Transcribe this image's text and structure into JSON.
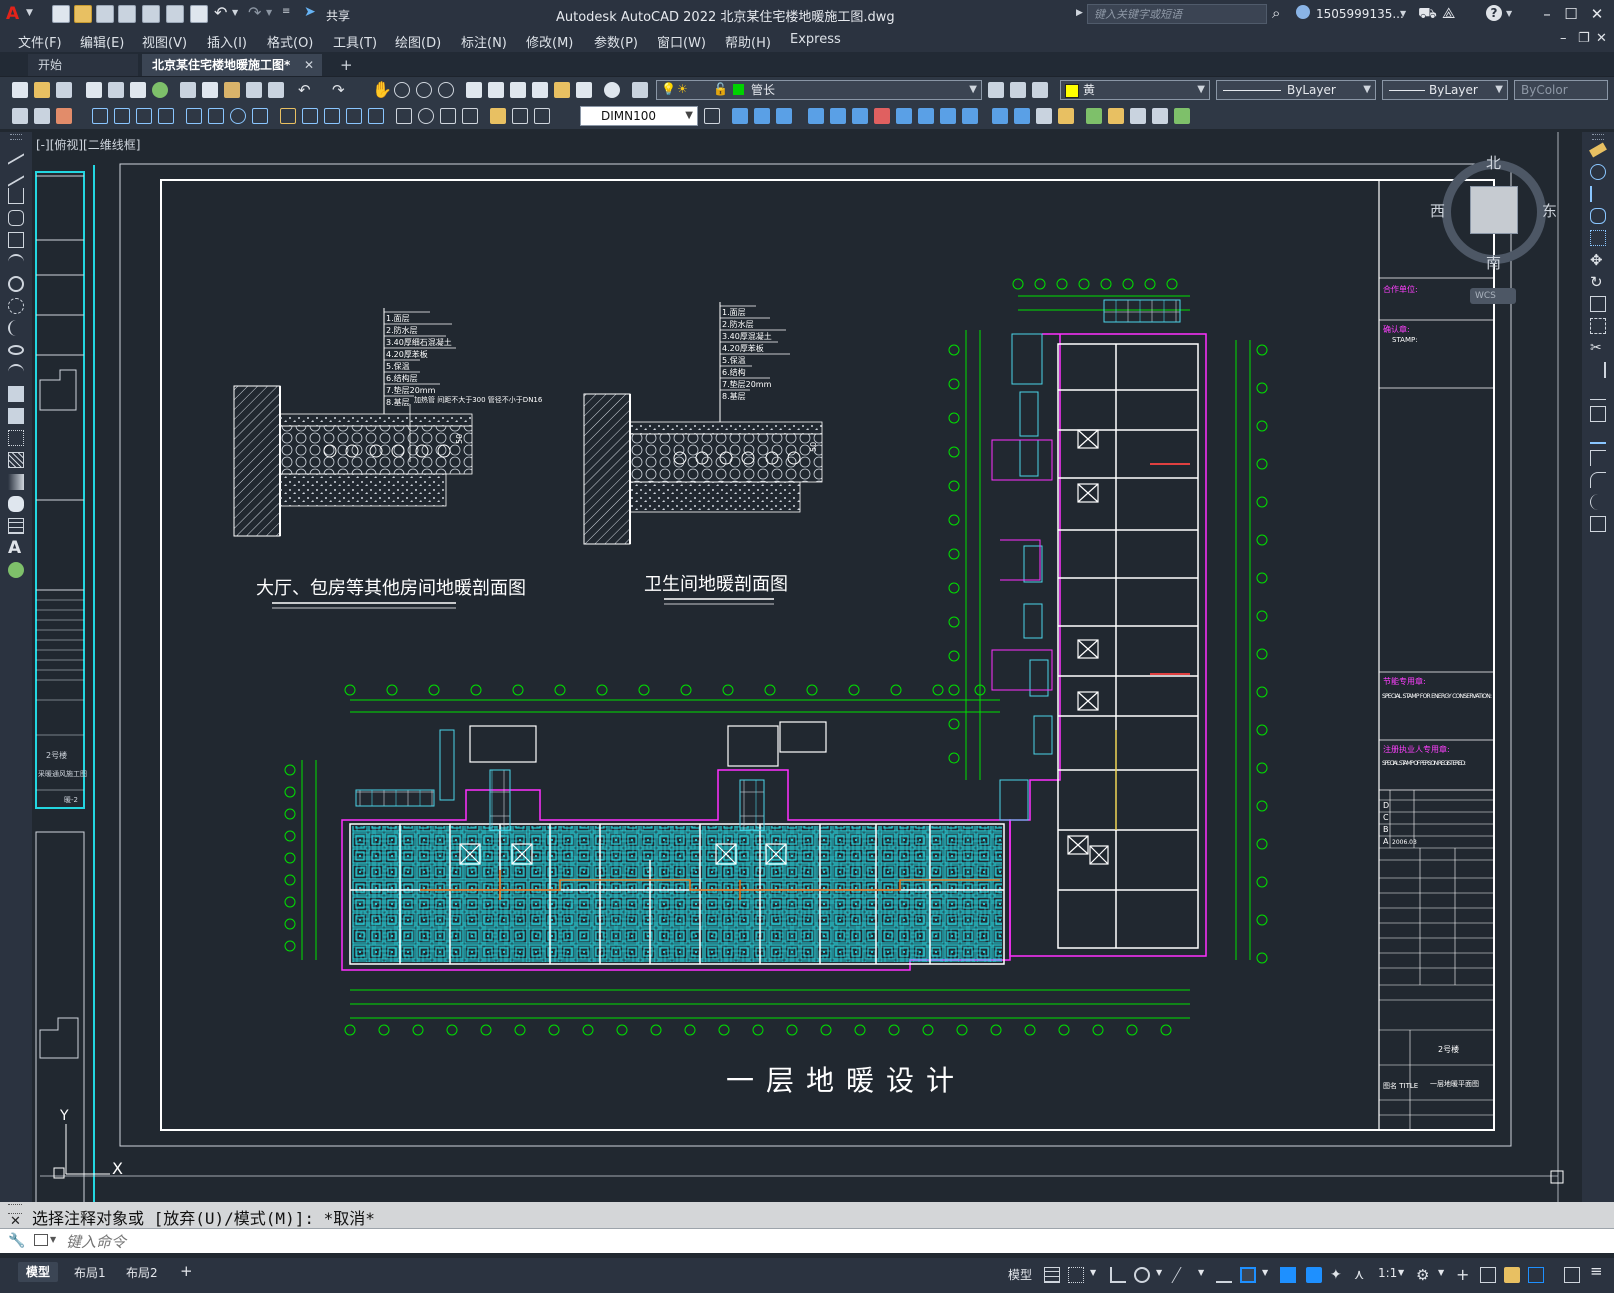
{
  "app": {
    "title": "Autodesk AutoCAD 2022    北京某住宅楼地暖施工图.dwg",
    "share": "共享",
    "search_placeholder": "键入关键字或短语",
    "user": "1505999135...",
    "accent": "#e2231a"
  },
  "menu": [
    "文件(F)",
    "编辑(E)",
    "视图(V)",
    "插入(I)",
    "格式(O)",
    "工具(T)",
    "绘图(D)",
    "标注(N)",
    "修改(M)",
    "参数(P)",
    "窗口(W)",
    "帮助(H)",
    "Express"
  ],
  "tabs": {
    "start": "开始",
    "file": "北京某住宅楼地暖施工图*",
    "close": "✕",
    "add": "+"
  },
  "toolbar": {
    "layer": "管长",
    "color": "黄",
    "linetype": "ByLayer",
    "lineweight": "ByLayer",
    "plotstyle": "ByColor",
    "dimstyle": "DIMN100"
  },
  "viewport": {
    "label": "[-][俯视][二维线框]",
    "compass": {
      "n": "北",
      "s": "南",
      "w": "西",
      "e": "东",
      "wcs": "WCS"
    },
    "ucs": {
      "x": "X",
      "y": "Y"
    }
  },
  "drawing": {
    "section1": "大厅、包房等其他房间地暖剖面图",
    "section2": "卫生间地暖剖面图",
    "plan_title": "一层地暖设计",
    "layers1": [
      "1.面层",
      "2.防水层",
      "3.40厚细石混凝土",
      "4.20厚苯板",
      "5.保温",
      "6.结构层",
      "7.垫层20mm",
      "8.基层"
    ],
    "layers2": [
      "1.面层",
      "2.防水层",
      "3.40厚混凝土",
      "4.20厚苯板",
      "5.保温",
      "6.结构",
      "7.垫层20mm",
      "8.基层"
    ],
    "note1": "加热管 间距不大于300 管径不小于DN16",
    "dim50": "50"
  },
  "titleblock": {
    "company": "合作单位:",
    "confirm": "确认章:",
    "stamp": "STAMP:",
    "energy": "节能专用章:",
    "energy_en": "SPECIAL STAMP FOR ENERGY CONSERVATION:",
    "person": "注册执业人专用章:",
    "person_en": "SPECIAL STAMP OF PERSON REGISTERED:",
    "rev": [
      "D",
      "C",
      "B",
      "A"
    ],
    "date": "2006.03",
    "proj": "2号楼",
    "title_label": "图名 TITLE",
    "title_val": "一层地暖平面图"
  },
  "left_strip": {
    "text1": "2号楼",
    "text2": "采暖通风施工图",
    "text3": "暖-2"
  },
  "command": {
    "history": "选择注释对象或 [放弃(U)/模式(M)]: *取消*",
    "prompt": "键入命令"
  },
  "status": {
    "model_tab": "模型",
    "layout1": "布局1",
    "layout2": "布局2",
    "add": "+",
    "mode": "模型",
    "scale": "1:1"
  }
}
